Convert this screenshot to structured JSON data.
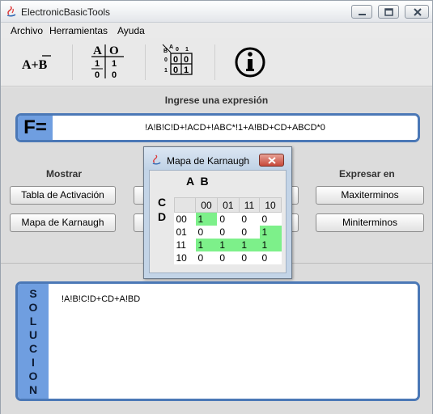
{
  "window": {
    "title": "ElectronicBasicTools"
  },
  "menu": [
    "Archivo",
    "Herramientas",
    "Ayuda"
  ],
  "toolbar": {
    "tools": [
      {
        "name": "boolean-expression-tool",
        "label": "A+B"
      },
      {
        "name": "truth-table-tool",
        "headers": [
          "A",
          "O"
        ],
        "rows": [
          [
            "1",
            "1"
          ],
          [
            "0",
            "0"
          ]
        ]
      },
      {
        "name": "karnaugh-tool",
        "corner": [
          "A",
          "B"
        ],
        "cols": [
          "0",
          "1"
        ],
        "rows": [
          [
            "0",
            "0",
            "0"
          ],
          [
            "1",
            "0",
            "1"
          ]
        ]
      },
      {
        "name": "info-tool",
        "label": "i"
      }
    ]
  },
  "main": {
    "prompt": "Ingrese una expresión",
    "f_label": "F=",
    "expression": "!A!B!C!D+!ACD+!ABC*!1+A!BD+CD+ABCD*0",
    "mostrar_label": "Mostrar",
    "expresar_label": "Expresar en",
    "buttons": {
      "tabla": "Tabla de Activación",
      "mapa": "Mapa de Karnaugh",
      "maxi": "Maxiterminos",
      "mini": "Miniterminos"
    },
    "solucion_letters": [
      "S",
      "O",
      "L",
      "U",
      "C",
      "I",
      "O",
      "N"
    ],
    "solution": "!A!B!C!D+CD+A!BD"
  },
  "dialog": {
    "title": "Mapa de Karnaugh",
    "ab_label": "A B",
    "cd_label": [
      "C",
      "D"
    ],
    "col_headers": [
      "00",
      "01",
      "11",
      "10"
    ],
    "rows": [
      {
        "label": "00",
        "cells": [
          "1",
          "0",
          "0",
          "0"
        ],
        "on": [
          true,
          false,
          false,
          false
        ]
      },
      {
        "label": "01",
        "cells": [
          "0",
          "0",
          "0",
          "1"
        ],
        "on": [
          false,
          false,
          false,
          true
        ]
      },
      {
        "label": "11",
        "cells": [
          "1",
          "1",
          "1",
          "1"
        ],
        "on": [
          true,
          true,
          true,
          true
        ]
      },
      {
        "label": "10",
        "cells": [
          "0",
          "0",
          "0",
          "0"
        ],
        "on": [
          false,
          false,
          false,
          false
        ]
      }
    ]
  }
}
